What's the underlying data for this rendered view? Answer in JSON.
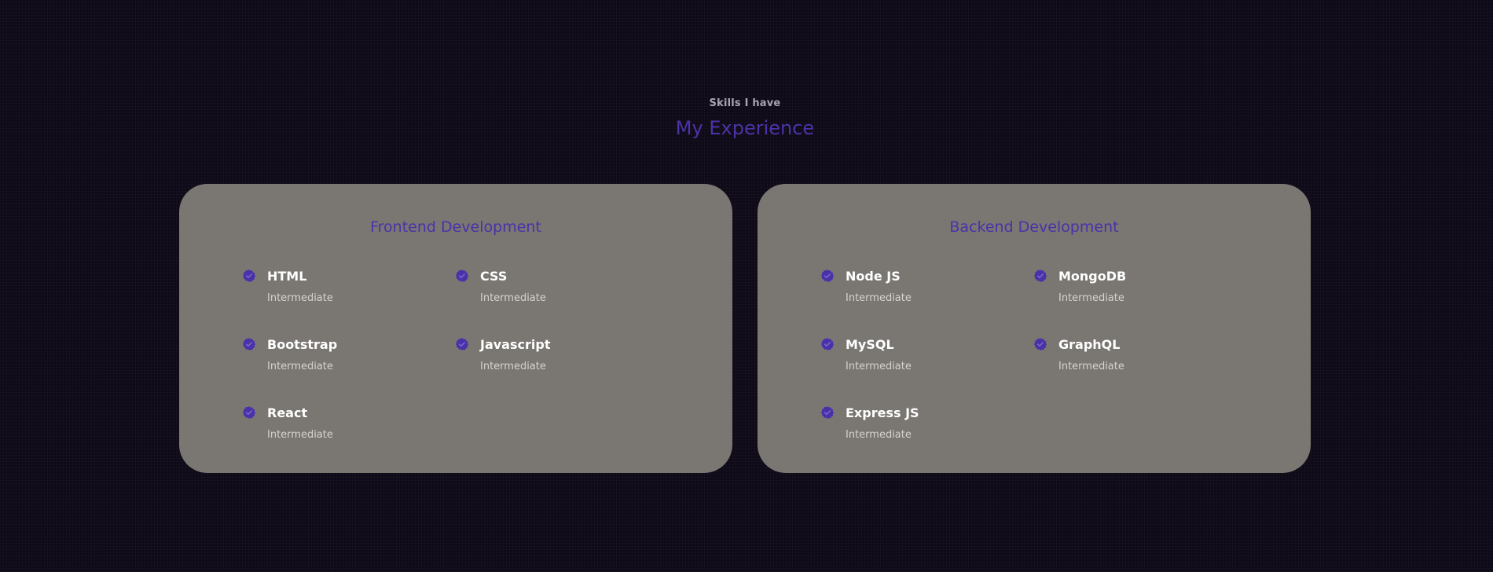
{
  "header": {
    "subtitle": "Skills I have",
    "title": "My Experience"
  },
  "colors": {
    "background": "#0f0a18",
    "card": "#7a7772",
    "accent": "#4a31aa",
    "skill_name": "#ffffff",
    "skill_level": "#d6d3ce",
    "subtitle": "#a8a4b2"
  },
  "icon": "verified-badge-icon",
  "frontend": {
    "title": "Frontend Development",
    "skills": [
      {
        "name": "HTML",
        "level": "Intermediate"
      },
      {
        "name": "CSS",
        "level": "Intermediate"
      },
      {
        "name": "Bootstrap",
        "level": "Intermediate"
      },
      {
        "name": "Javascript",
        "level": "Intermediate"
      },
      {
        "name": "React",
        "level": "Intermediate"
      }
    ]
  },
  "backend": {
    "title": "Backend Development",
    "skills": [
      {
        "name": "Node JS",
        "level": "Intermediate"
      },
      {
        "name": "MongoDB",
        "level": "Intermediate"
      },
      {
        "name": "MySQL",
        "level": "Intermediate"
      },
      {
        "name": "GraphQL",
        "level": "Intermediate"
      },
      {
        "name": "Express JS",
        "level": "Intermediate"
      }
    ]
  }
}
